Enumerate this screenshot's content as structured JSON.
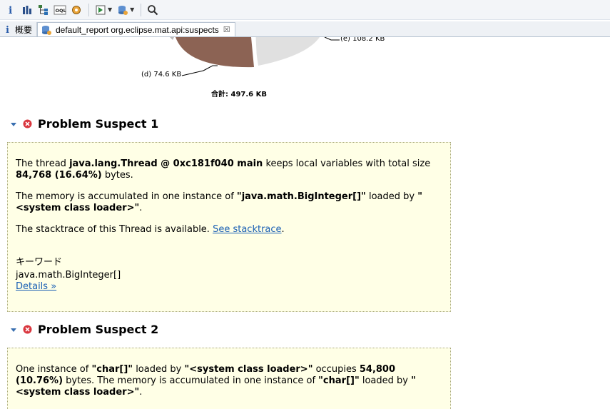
{
  "toolbar": {
    "icons": [
      "info-icon",
      "histogram-icon",
      "dominator-tree-icon",
      "oql-icon",
      "heap-dump-details-icon",
      "run-report-icon",
      "query-browser-icon",
      "search-icon"
    ],
    "oql_label": "OQL"
  },
  "tabs": [
    {
      "label": "概要",
      "icon": "info-icon"
    },
    {
      "label": "default_report  org.eclipse.mat.api:suspects",
      "icon": "report-icon",
      "close": "☒"
    }
  ],
  "pie": {
    "labels": {
      "d": "(d)  74.6 KB",
      "e": "(e)  108.2 KB"
    },
    "total": "合計: 497.6 KB",
    "colors": {
      "d": "#8c6354",
      "e": "#e0e0e0"
    }
  },
  "suspect1": {
    "title": "Problem Suspect 1",
    "p1_a": "The thread ",
    "p1_b": "java.lang.Thread @ 0xc181f040 main",
    "p1_c": " keeps local variables with total size ",
    "p1_d": "84,768 (16.64%)",
    "p1_e": " bytes.",
    "p2_a": "The memory is accumulated in one instance of ",
    "p2_b": "\"java.math.BigInteger[]\"",
    "p2_c": " loaded by ",
    "p2_d": "\"<system class loader>\"",
    "p2_e": ".",
    "p3_a": "The stacktrace of this Thread is available. ",
    "p3_link": "See stacktrace",
    "p3_b": ".",
    "keywords_title": "キーワード",
    "keyword": "java.math.BigInteger[]",
    "details": "Details »"
  },
  "suspect2": {
    "title": "Problem Suspect 2",
    "p1_a": "One instance of ",
    "p1_b": "\"char[]\"",
    "p1_c": " loaded by ",
    "p1_d": "\"<system class loader>\"",
    "p1_e": " occupies ",
    "p1_f": "54,800 (10.76%)",
    "p1_g": " bytes. The memory is accumulated in one instance of ",
    "p1_h": "\"char[]\"",
    "p1_i": " loaded by ",
    "p1_j": "\"<system class loader>\"",
    "p1_k": "."
  },
  "colors": {
    "box_bg": "#ffffe6",
    "link": "#1a5fb4",
    "error_red": "#d9363e"
  }
}
